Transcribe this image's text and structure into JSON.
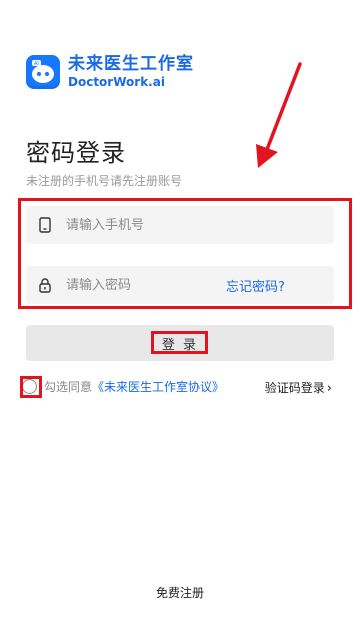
{
  "brand": {
    "name_cn": "未来医生工作室",
    "name_en": "DoctorWork.ai"
  },
  "page": {
    "title": "密码登录",
    "subtitle": "未注册的手机号请先注册账号"
  },
  "form": {
    "phone_placeholder": "请输入手机号",
    "password_placeholder": "请输入密码",
    "forgot_label": "忘记密码?"
  },
  "actions": {
    "login_label": "登 录",
    "agree_prefix": "勾选同意",
    "agreement_link": "《未来医生工作室协议》",
    "code_login_label": "验证码登录",
    "register_label": "免费注册"
  },
  "colors": {
    "accent": "#1a6ae8",
    "highlight": "#e1141f"
  },
  "icons": [
    "phone-icon",
    "lock-icon",
    "chevron-right-icon",
    "arrow-annotation"
  ]
}
